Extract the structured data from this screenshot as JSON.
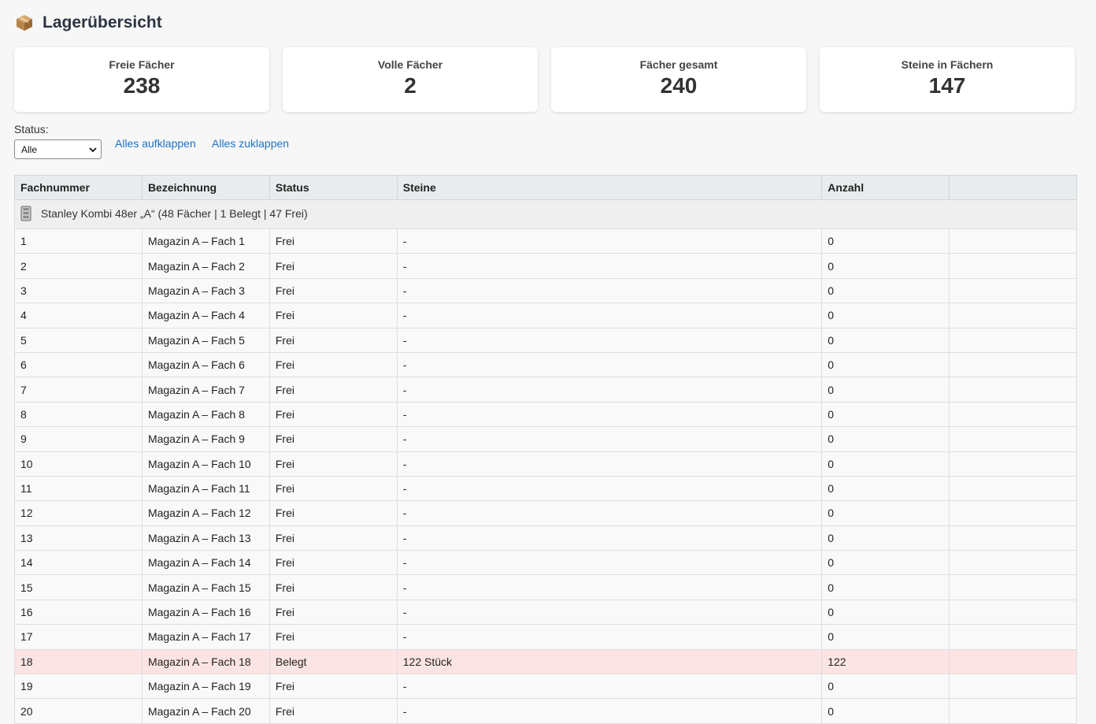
{
  "header": {
    "icon": "package-icon",
    "title": "Lagerübersicht"
  },
  "stats": [
    {
      "label": "Freie Fächer",
      "value": "238"
    },
    {
      "label": "Volle Fächer",
      "value": "2"
    },
    {
      "label": "Fächer gesamt",
      "value": "240"
    },
    {
      "label": "Steine in Fächern",
      "value": "147"
    }
  ],
  "filter": {
    "label": "Status:",
    "selected": "Alle"
  },
  "links": {
    "expand_all": "Alles aufklappen",
    "collapse_all": "Alles zuklappen"
  },
  "table": {
    "columns": [
      "Fachnummer",
      "Bezeichnung",
      "Status",
      "Steine",
      "Anzahl",
      ""
    ],
    "group": {
      "icon": "cabinet-icon",
      "label": "Stanley Kombi 48er „A“ (48 Fächer | 1 Belegt | 47 Frei)"
    },
    "rows": [
      {
        "nr": "1",
        "name": "Magazin A – Fach 1",
        "status": "Frei",
        "steine": "-",
        "anzahl": "0"
      },
      {
        "nr": "2",
        "name": "Magazin A – Fach 2",
        "status": "Frei",
        "steine": "-",
        "anzahl": "0"
      },
      {
        "nr": "3",
        "name": "Magazin A – Fach 3",
        "status": "Frei",
        "steine": "-",
        "anzahl": "0"
      },
      {
        "nr": "4",
        "name": "Magazin A – Fach 4",
        "status": "Frei",
        "steine": "-",
        "anzahl": "0"
      },
      {
        "nr": "5",
        "name": "Magazin A – Fach 5",
        "status": "Frei",
        "steine": "-",
        "anzahl": "0"
      },
      {
        "nr": "6",
        "name": "Magazin A – Fach 6",
        "status": "Frei",
        "steine": "-",
        "anzahl": "0"
      },
      {
        "nr": "7",
        "name": "Magazin A – Fach 7",
        "status": "Frei",
        "steine": "-",
        "anzahl": "0"
      },
      {
        "nr": "8",
        "name": "Magazin A – Fach 8",
        "status": "Frei",
        "steine": "-",
        "anzahl": "0"
      },
      {
        "nr": "9",
        "name": "Magazin A – Fach 9",
        "status": "Frei",
        "steine": "-",
        "anzahl": "0"
      },
      {
        "nr": "10",
        "name": "Magazin A – Fach 10",
        "status": "Frei",
        "steine": "-",
        "anzahl": "0"
      },
      {
        "nr": "11",
        "name": "Magazin A – Fach 11",
        "status": "Frei",
        "steine": "-",
        "anzahl": "0"
      },
      {
        "nr": "12",
        "name": "Magazin A – Fach 12",
        "status": "Frei",
        "steine": "-",
        "anzahl": "0"
      },
      {
        "nr": "13",
        "name": "Magazin A – Fach 13",
        "status": "Frei",
        "steine": "-",
        "anzahl": "0"
      },
      {
        "nr": "14",
        "name": "Magazin A – Fach 14",
        "status": "Frei",
        "steine": "-",
        "anzahl": "0"
      },
      {
        "nr": "15",
        "name": "Magazin A – Fach 15",
        "status": "Frei",
        "steine": "-",
        "anzahl": "0"
      },
      {
        "nr": "16",
        "name": "Magazin A – Fach 16",
        "status": "Frei",
        "steine": "-",
        "anzahl": "0"
      },
      {
        "nr": "17",
        "name": "Magazin A – Fach 17",
        "status": "Frei",
        "steine": "-",
        "anzahl": "0"
      },
      {
        "nr": "18",
        "name": "Magazin A – Fach 18",
        "status": "Belegt",
        "steine": "122 Stück",
        "anzahl": "122"
      },
      {
        "nr": "19",
        "name": "Magazin A – Fach 19",
        "status": "Frei",
        "steine": "-",
        "anzahl": "0"
      },
      {
        "nr": "20",
        "name": "Magazin A – Fach 20",
        "status": "Frei",
        "steine": "-",
        "anzahl": "0"
      }
    ]
  },
  "colors": {
    "link": "#1a73c9",
    "occupied_row": "#fde4e4",
    "header_bg": "#e9ecee"
  }
}
